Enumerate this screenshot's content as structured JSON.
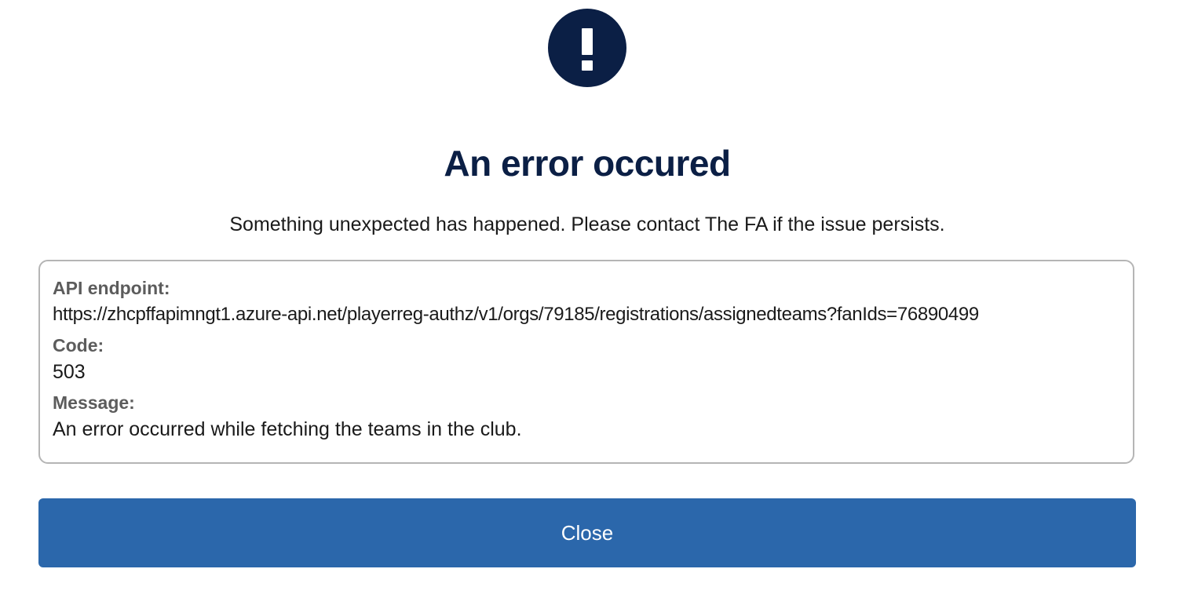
{
  "dialog": {
    "icon": "exclamation-icon",
    "title": "An error occured",
    "subtitle": "Something unexpected has happened. Please contact The FA if the issue persists.",
    "details": {
      "endpoint_label": "API endpoint:",
      "endpoint_value": "https://zhcpffapimngt1.azure-api.net/playerreg-authz/v1/orgs/79185/registrations/assignedteams?fanIds=76890499",
      "code_label": "Code:",
      "code_value": "503",
      "message_label": "Message:",
      "message_value": "An error occurred while fetching the teams in the club."
    },
    "close_label": "Close"
  },
  "colors": {
    "navy": "#0b1f45",
    "button_blue": "#2b67ab",
    "border_gray": "#b5b5b5",
    "label_gray": "#5c5c5c"
  }
}
